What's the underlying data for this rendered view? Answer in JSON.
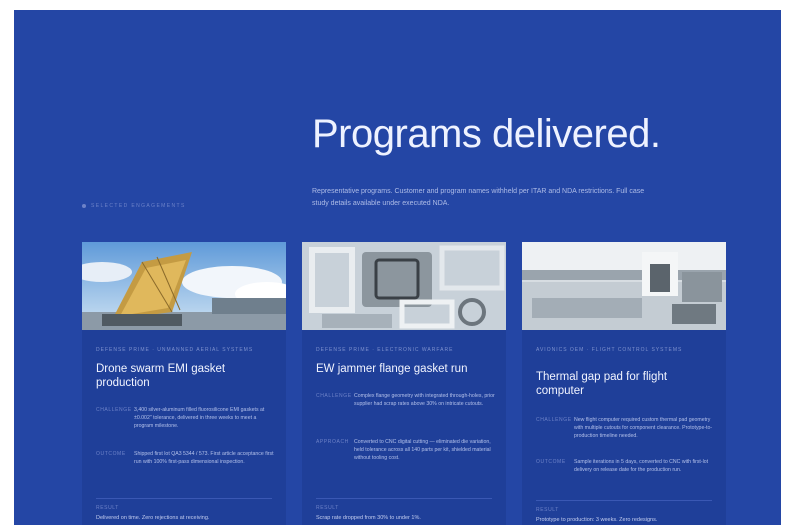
{
  "hero": {
    "title": "Programs delivered.",
    "description": "Representative programs. Customer and program names withheld per ITAR and NDA restrictions. Full case study details available under executed NDA.",
    "side_label": "SELECTED ENGAGEMENTS"
  },
  "cards": [
    {
      "tag": "DEFENSE PRIME · UNMANNED AERIAL SYSTEMS",
      "title": "Drone swarm EMI gasket production",
      "specs": [
        {
          "key": "CHALLENGE",
          "value": "3,400 silver-aluminum filled fluorosilicone EMI gaskets at ±0.002\" tolerance, delivered in three weeks to meet a program milestone."
        },
        {
          "key": "OUTCOME",
          "value": "Shipped first lot QA3 5344 / 573. First article acceptance first run with 100% first-pass dimensional inspection."
        }
      ],
      "footer_key": "RESULT",
      "footer_value": "Delivered on time. Zero rejections at receiving."
    },
    {
      "tag": "DEFENSE PRIME · ELECTRONIC WARFARE",
      "title": "EW jammer flange gasket run",
      "specs": [
        {
          "key": "CHALLENGE",
          "value": "Complex flange geometry with integrated through-holes, prior supplier had scrap rates above 30% on intricate cutouts."
        },
        {
          "key": "APPROACH",
          "value": "Converted to CNC digital cutting — eliminated die variation, held tolerance across all 140 parts per kit, shielded material without tooling cost."
        }
      ],
      "footer_key": "RESULT",
      "footer_value": "Scrap rate dropped from 30% to under 1%."
    },
    {
      "tag": "AVIONICS OEM · FLIGHT CONTROL SYSTEMS",
      "title": "Thermal gap pad for flight computer",
      "specs": [
        {
          "key": "CHALLENGE",
          "value": "New flight computer required custom thermal pad geometry with multiple cutouts for component clearance. Prototype-to-production timeline needed."
        },
        {
          "key": "OUTCOME",
          "value": "Sample iterations in 5 days, converted to CNC with first-lot delivery on release date for the production run."
        }
      ],
      "footer_key": "RESULT",
      "footer_value": "Prototype to production: 3 weeks. Zero redesigns."
    }
  ]
}
